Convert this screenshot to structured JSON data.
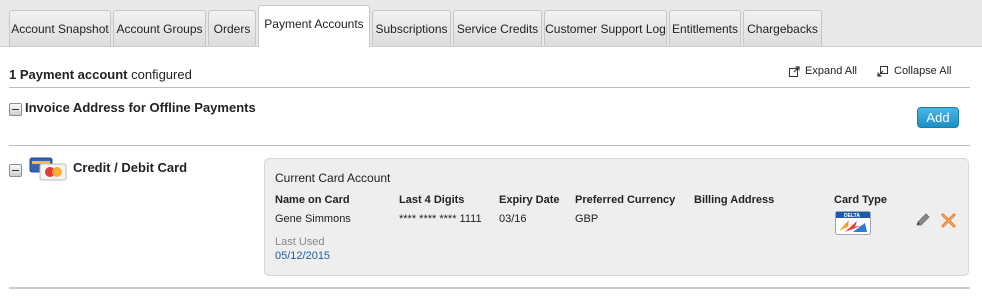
{
  "tabs": [
    {
      "label": "Account Snapshot"
    },
    {
      "label": "Account Groups"
    },
    {
      "label": "Orders"
    },
    {
      "label": "Payment Accounts",
      "active": true
    },
    {
      "label": "Subscriptions"
    },
    {
      "label": "Service Credits"
    },
    {
      "label": "Customer Support Log"
    },
    {
      "label": "Entitlements"
    },
    {
      "label": "Chargebacks"
    }
  ],
  "summary": {
    "count": "1 Payment account",
    "suffix": " configured"
  },
  "toolbar": {
    "expand_all": "Expand All",
    "collapse_all": "Collapse All"
  },
  "sections": {
    "invoice": {
      "title": "Invoice Address for Offline Payments",
      "add_label": "Add"
    },
    "card": {
      "title": "Credit / Debit Card"
    }
  },
  "card_panel": {
    "title": "Current Card Account",
    "headers": {
      "name": "Name on Card",
      "last4": "Last 4 Digits",
      "expiry": "Expiry Date",
      "currency": "Preferred Currency",
      "billing": "Billing Address",
      "card_type": "Card Type"
    },
    "values": {
      "name": "Gene Simmons",
      "last4": "**** **** **** 1111",
      "expiry": "03/16",
      "currency": "GBP",
      "billing": ""
    },
    "last_used_label": "Last Used",
    "last_used_value": "05/12/2015",
    "card_brand_text": "DELTA"
  },
  "colors": {
    "add_button": "#1d8fc4",
    "delete_icon": "#e8792b",
    "last_used": "#1f5fa0"
  }
}
